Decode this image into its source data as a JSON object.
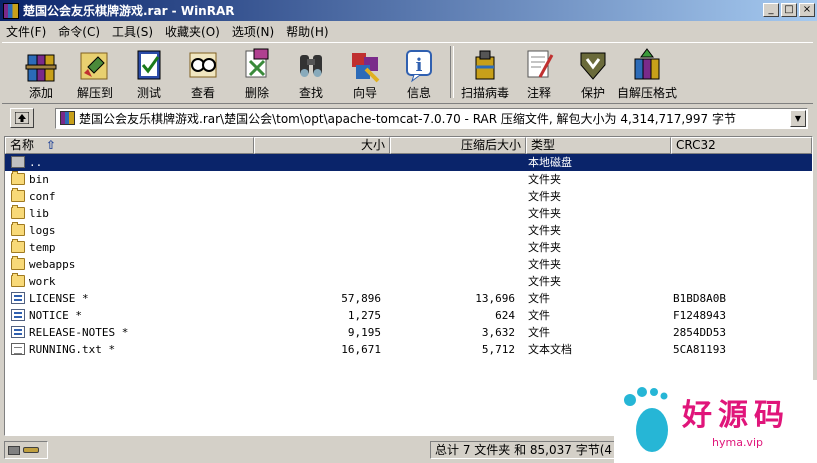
{
  "window": {
    "title": "楚国公会友乐棋牌游戏.rar - WinRAR",
    "buttons": {
      "minimize": "_",
      "maximize": "□",
      "close": "×"
    }
  },
  "menu": [
    "文件(F)",
    "命令(C)",
    "工具(S)",
    "收藏夹(O)",
    "选项(N)",
    "帮助(H)"
  ],
  "toolbar": {
    "buttons": [
      {
        "label": "添加",
        "icon": "add-archive-icon"
      },
      {
        "label": "解压到",
        "icon": "extract-to-icon"
      },
      {
        "label": "测试",
        "icon": "test-icon"
      },
      {
        "label": "查看",
        "icon": "view-icon"
      },
      {
        "label": "删除",
        "icon": "delete-icon"
      },
      {
        "label": "查找",
        "icon": "find-icon"
      },
      {
        "label": "向导",
        "icon": "wizard-icon"
      },
      {
        "label": "信息",
        "icon": "info-icon"
      }
    ],
    "buttons2": [
      {
        "label": "扫描病毒",
        "icon": "virus-scan-icon"
      },
      {
        "label": "注释",
        "icon": "comment-icon"
      },
      {
        "label": "保护",
        "icon": "protect-icon"
      },
      {
        "label": "自解压格式",
        "icon": "sfx-icon"
      }
    ]
  },
  "address": {
    "path": "楚国公会友乐棋牌游戏.rar\\楚国公会\\tom\\opt\\apache-tomcat-7.0.70 - RAR 压缩文件, 解包大小为 4,314,717,997 字节"
  },
  "columns": {
    "name": "名称",
    "size": "大小",
    "packed": "压缩后大小",
    "type": "类型",
    "crc": "CRC32"
  },
  "files": [
    {
      "name": "..",
      "size": "",
      "packed": "",
      "type": "本地磁盘",
      "crc": "",
      "kind": "drive",
      "selected": true
    },
    {
      "name": "bin",
      "size": "",
      "packed": "",
      "type": "文件夹",
      "crc": "",
      "kind": "folder"
    },
    {
      "name": "conf",
      "size": "",
      "packed": "",
      "type": "文件夹",
      "crc": "",
      "kind": "folder"
    },
    {
      "name": "lib",
      "size": "",
      "packed": "",
      "type": "文件夹",
      "crc": "",
      "kind": "folder"
    },
    {
      "name": "logs",
      "size": "",
      "packed": "",
      "type": "文件夹",
      "crc": "",
      "kind": "folder"
    },
    {
      "name": "temp",
      "size": "",
      "packed": "",
      "type": "文件夹",
      "crc": "",
      "kind": "folder"
    },
    {
      "name": "webapps",
      "size": "",
      "packed": "",
      "type": "文件夹",
      "crc": "",
      "kind": "folder"
    },
    {
      "name": "work",
      "size": "",
      "packed": "",
      "type": "文件夹",
      "crc": "",
      "kind": "folder"
    },
    {
      "name": "LICENSE *",
      "size": "57,896",
      "packed": "13,696",
      "type": "文件",
      "crc": "B1BD8A0B",
      "kind": "file"
    },
    {
      "name": "NOTICE *",
      "size": "1,275",
      "packed": "624",
      "type": "文件",
      "crc": "F1248943",
      "kind": "file"
    },
    {
      "name": "RELEASE-NOTES *",
      "size": "9,195",
      "packed": "3,632",
      "type": "文件",
      "crc": "2854DD53",
      "kind": "file"
    },
    {
      "name": "RUNNING.txt *",
      "size": "16,671",
      "packed": "5,712",
      "type": "文本文档",
      "crc": "5CA81193",
      "kind": "text"
    }
  ],
  "status": {
    "summary": "总计 7 文件夹 和 85,037 字节(4"
  },
  "watermark": {
    "brand": "好源码",
    "url": "hyma.vip"
  },
  "colors": {
    "title_start": "#0a246a",
    "title_end": "#a6caf0",
    "selection": "#0a246a",
    "watermark": "#e0157a"
  }
}
